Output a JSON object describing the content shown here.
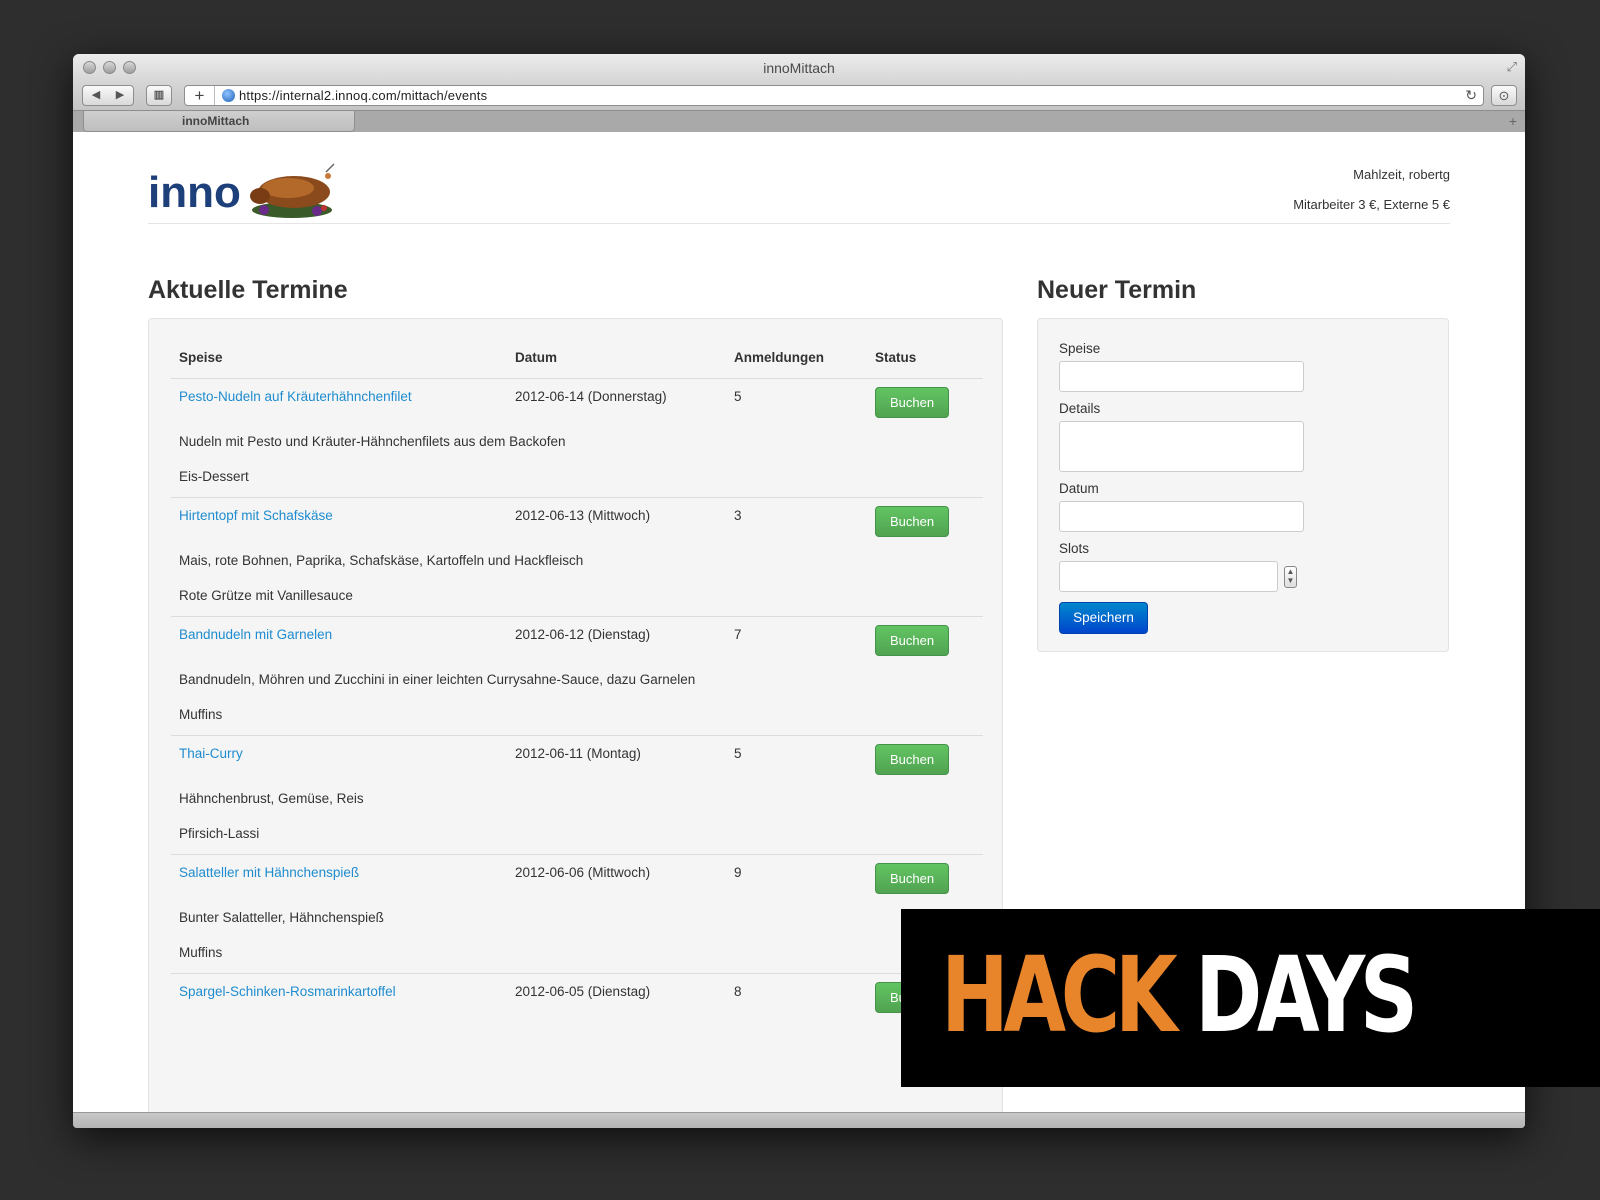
{
  "browser": {
    "window_title": "innoMittach",
    "url": "https://internal2.innoq.com/mittach/events",
    "tab_title": "innoMittach"
  },
  "header": {
    "logo_text": "inno",
    "greeting": "Mahlzeit, robertg",
    "prices": "Mitarbeiter 3 €, Externe 5 €"
  },
  "events": {
    "heading": "Aktuelle Termine",
    "columns": [
      "Speise",
      "Datum",
      "Anmeldungen",
      "Status"
    ],
    "book_label": "Buchen",
    "items": [
      {
        "dish": "Pesto-Nudeln auf Kräuterhähnchenfilet",
        "date": "2012-06-14 (Donnerstag)",
        "signups": "5",
        "details": "Nudeln mit Pesto und Kräuter-Hähnchenfilets aus dem Backofen",
        "dessert": "Eis-Dessert"
      },
      {
        "dish": "Hirtentopf mit Schafskäse",
        "date": "2012-06-13 (Mittwoch)",
        "signups": "3",
        "details": "Mais, rote Bohnen, Paprika, Schafskäse, Kartoffeln und Hackfleisch",
        "dessert": "Rote Grütze mit Vanillesauce"
      },
      {
        "dish": "Bandnudeln mit Garnelen",
        "date": "2012-06-12 (Dienstag)",
        "signups": "7",
        "details": "Bandnudeln, Möhren und Zucchini in einer leichten Currysahne-Sauce, dazu Garnelen",
        "dessert": "Muffins"
      },
      {
        "dish": "Thai-Curry",
        "date": "2012-06-11 (Montag)",
        "signups": "5",
        "details": "Hähnchenbrust, Gemüse, Reis",
        "dessert": "Pfirsich-Lassi"
      },
      {
        "dish": "Salatteller mit Hähnchenspieß",
        "date": "2012-06-06 (Mittwoch)",
        "signups": "9",
        "details": "Bunter Salatteller, Hähnchenspieß",
        "dessert": "Muffins"
      },
      {
        "dish": "Spargel-Schinken-Rosmarinkartoffel",
        "date": "2012-06-05 (Dienstag)",
        "signups": "8",
        "details": "",
        "dessert": ""
      }
    ]
  },
  "new_event": {
    "heading": "Neuer Termin",
    "fields": {
      "speise": "Speise",
      "details": "Details",
      "datum": "Datum",
      "slots": "Slots"
    },
    "save_label": "Speichern"
  },
  "overlay": {
    "word1": "HACK",
    "word2": "DAYS"
  },
  "colors": {
    "link": "#1e8ccf",
    "buchen_button": "#5bb75b",
    "save_button": "#0066cc",
    "overlay_accent": "#e8852a"
  }
}
